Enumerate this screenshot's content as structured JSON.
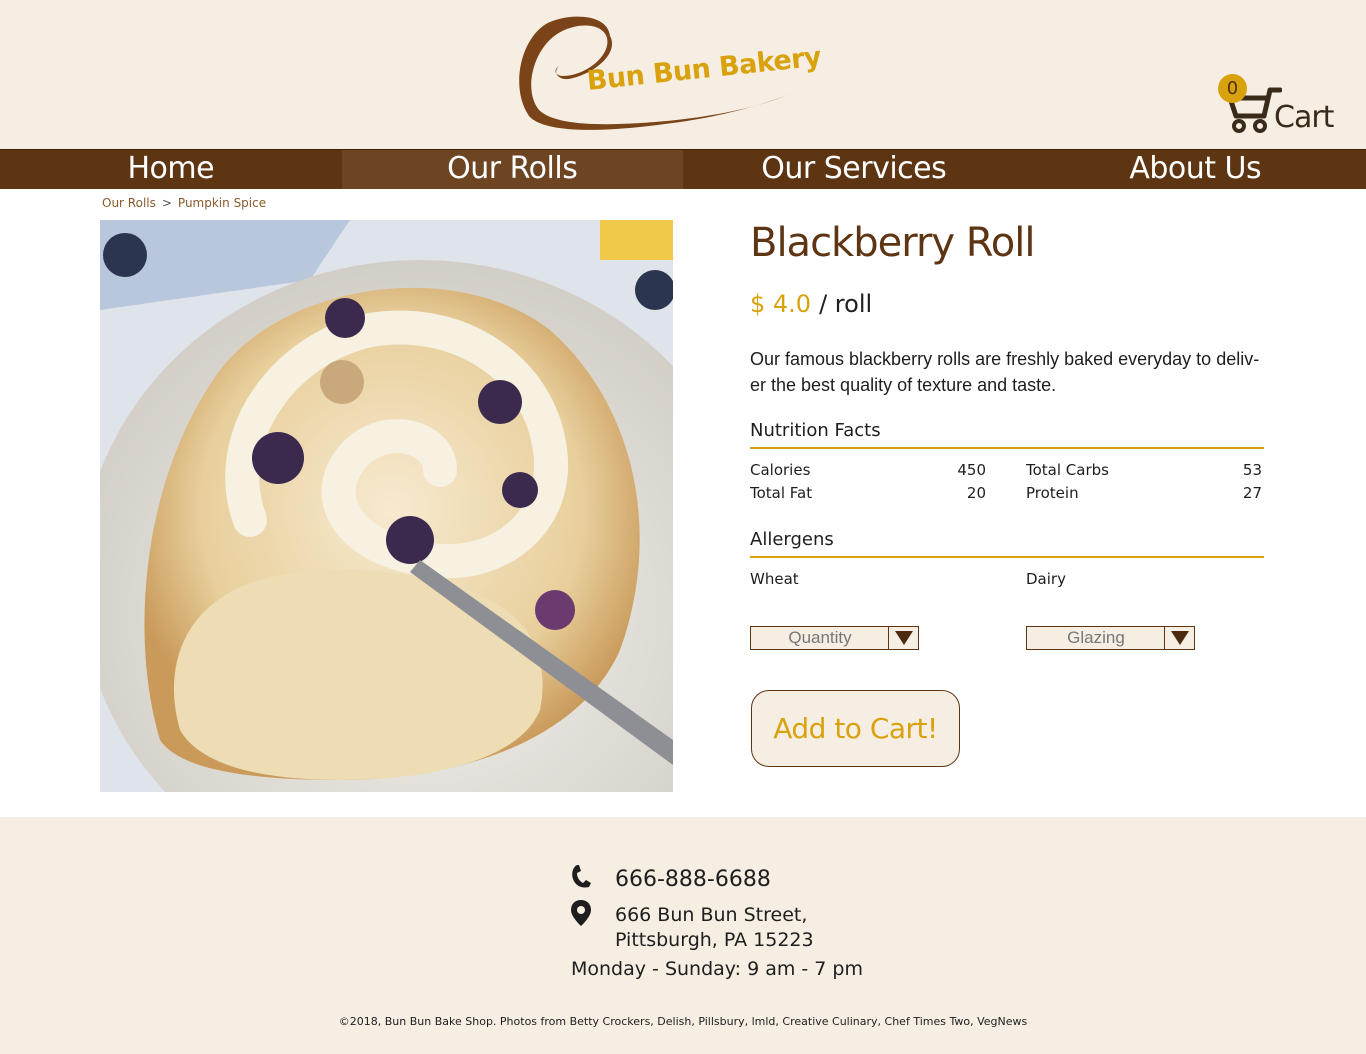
{
  "brand": {
    "name": "Bun Bun Bakery",
    "colors": {
      "brown": "#5e3513",
      "gold": "#d9a20c",
      "cream": "#f6eee3"
    }
  },
  "cart": {
    "count": "0",
    "label": "Cart",
    "icon": "shopping-cart-icon"
  },
  "nav": {
    "items": [
      {
        "label": "Home",
        "active": false
      },
      {
        "label": "Our Rolls",
        "active": true
      },
      {
        "label": "Our Services",
        "active": false
      },
      {
        "label": "About Us",
        "active": false
      }
    ]
  },
  "breadcrumb": {
    "parent": "Our Rolls",
    "separator": ">",
    "current": "Pumpkin Spice"
  },
  "product": {
    "image_alt": "Blackberry roll on a plate with a fork",
    "title": "Blackberry Roll",
    "price": "$ 4.0",
    "unit": "/ roll",
    "description": "Our famous blackberry rolls are freshly baked everyday to deliv-er the best quality of texture and taste.",
    "description_lines": [
      "Our famous blackberry rolls are freshly baked everyday to deliv-",
      "er the best quality of texture and taste."
    ]
  },
  "nutrition": {
    "heading": "Nutrition Facts",
    "left": [
      {
        "label": "Calories",
        "value": "450"
      },
      {
        "label": "Total Fat",
        "value": "20"
      }
    ],
    "right": [
      {
        "label": "Total Carbs",
        "value": "53"
      },
      {
        "label": "Protein",
        "value": "27"
      }
    ]
  },
  "allergens": {
    "heading": "Allergens",
    "items": [
      "Wheat",
      "Dairy"
    ]
  },
  "options": {
    "quantity": "Quantity",
    "glazing": "Glazing"
  },
  "add_to_cart": "Add to Cart!",
  "footer": {
    "phone": "666-888-6688",
    "address_line1": "666 Bun Bun Street,",
    "address_line2": "Pittsburgh, PA 15223",
    "hours": "Monday - Sunday: 9 am - 7 pm",
    "copyright": "©2018, Bun Bun Bake Shop. Photos from Betty Crockers, Delish, Pillsbury, lmld, Creative Culinary, Chef Times Two, VegNews"
  }
}
